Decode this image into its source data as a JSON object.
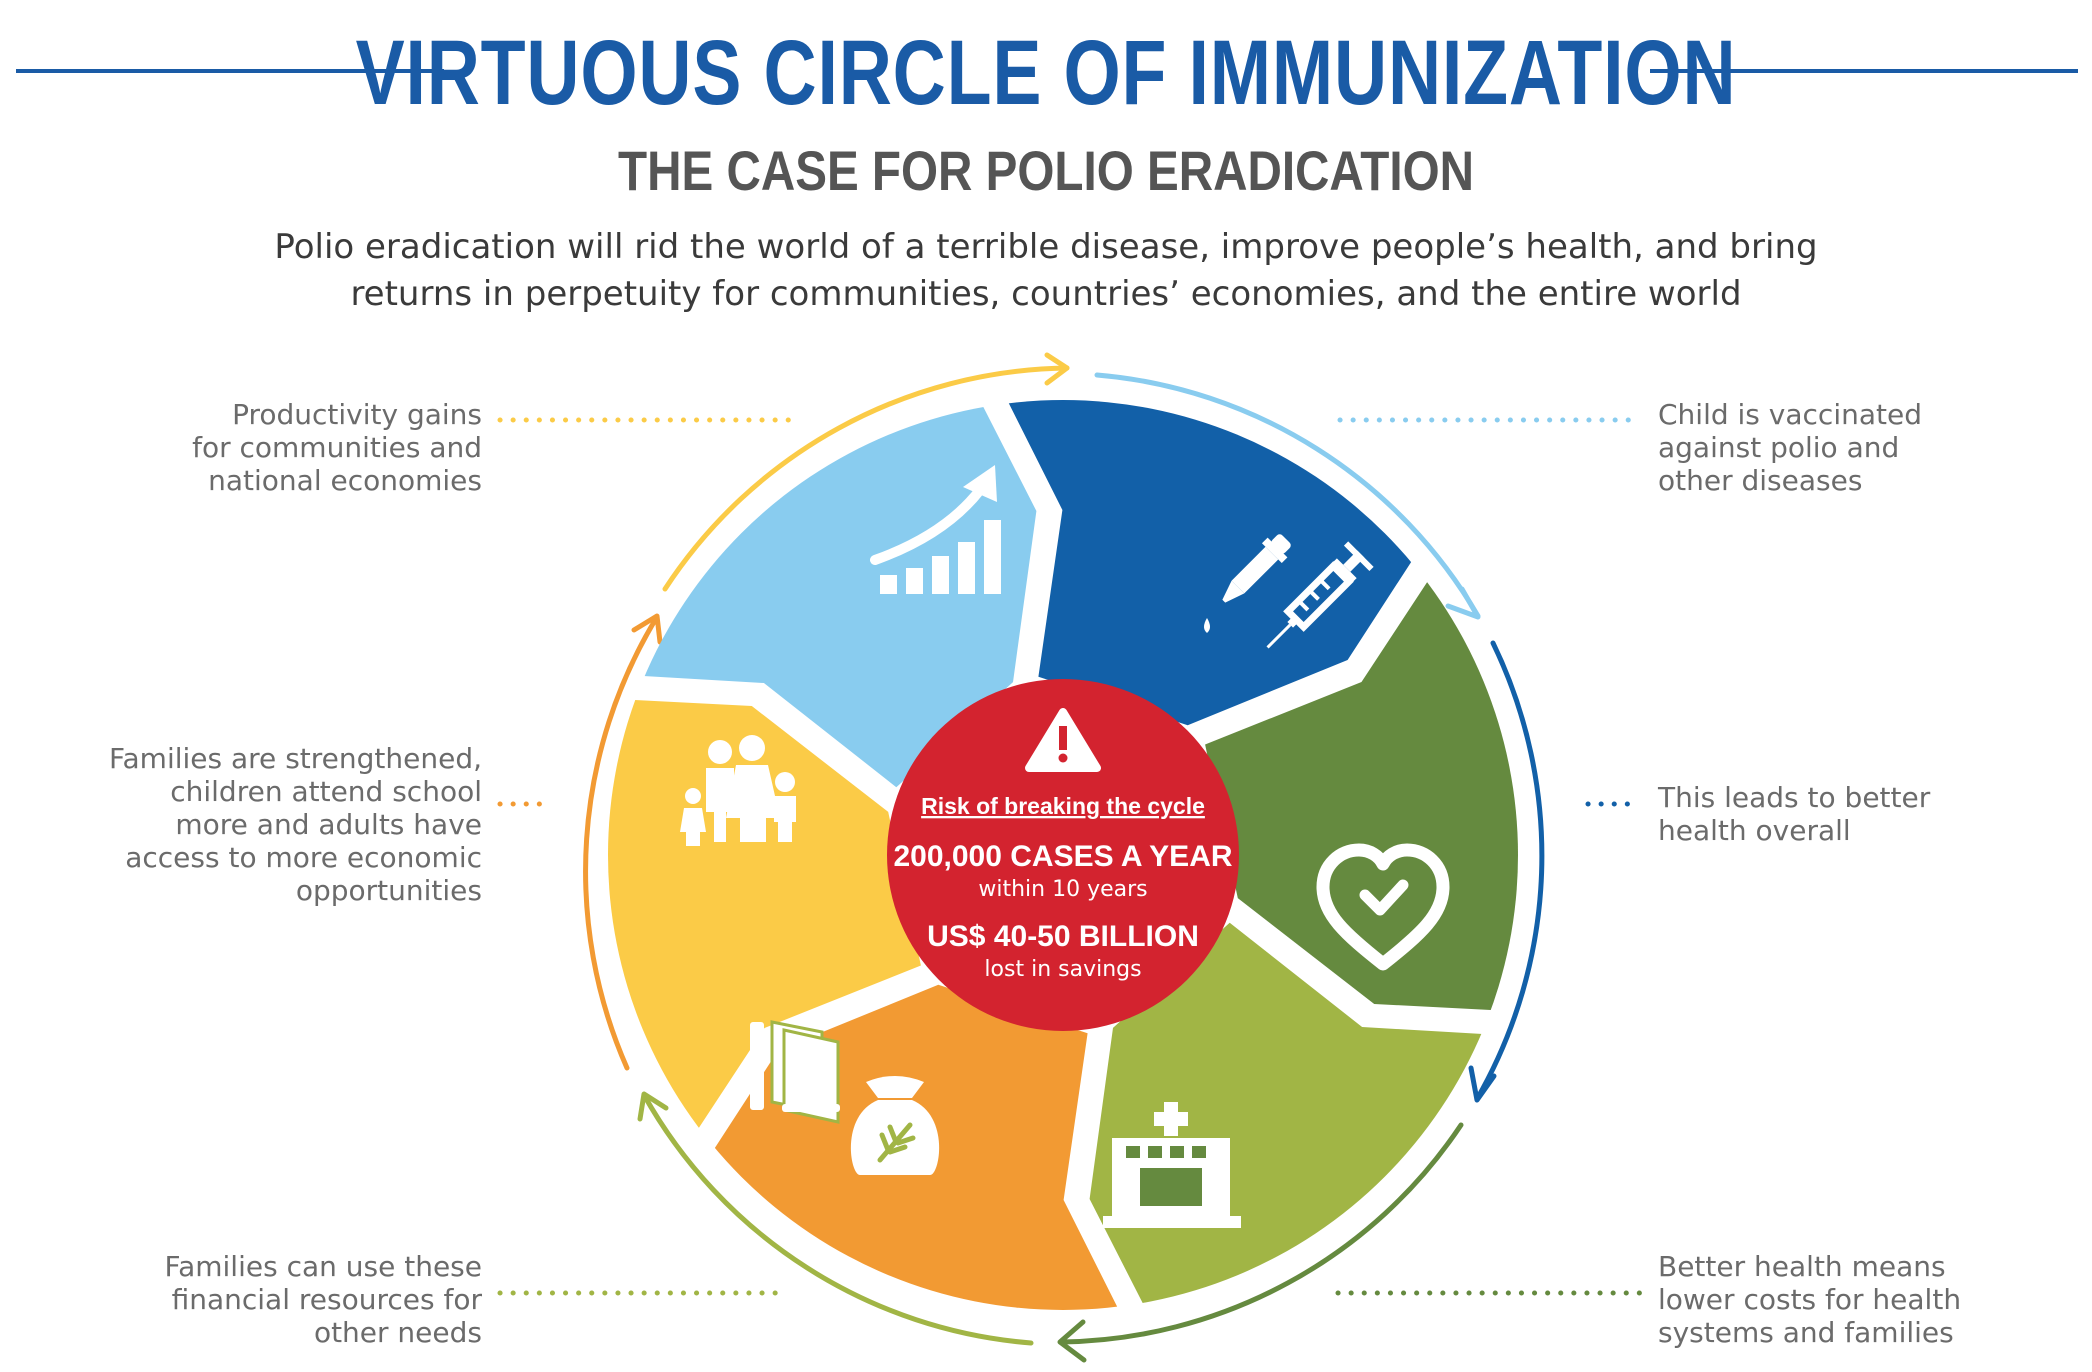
{
  "header": {
    "title": "VIRTUOUS CIRCLE OF IMMUNIZATION",
    "subtitle": "THE CASE FOR POLIO ERADICATION",
    "intro_line1": "Polio eradication will rid the world of a terrible disease, improve people’s health, and bring",
    "intro_line2": "returns in perpetuity for communities, countries’ economies, and the entire world"
  },
  "center": {
    "heading": "Risk of breaking the cycle",
    "stat1": "200,000 CASES A YEAR",
    "stat1_note": "within 10 years",
    "stat2": "US$ 40-50 BILLION",
    "stat2_note": "lost in savings"
  },
  "segments": [
    {
      "id": "vaccinated",
      "icon": "dropper-syringe-icon",
      "color": "#89CCEF",
      "arrow_color": "#89CCEF",
      "caption": [
        "Child is vaccinated",
        "against polio and",
        "other diseases"
      ]
    },
    {
      "id": "health",
      "icon": "heart-check-icon",
      "color": "#1260A8",
      "arrow_color": "#1260A8",
      "caption": [
        "This leads to better",
        "health overall"
      ]
    },
    {
      "id": "costs",
      "icon": "hospital-icon",
      "color": "#658A3F",
      "arrow_color": "#658A3F",
      "caption": [
        "Better health means",
        "lower costs for health",
        "systems and families"
      ]
    },
    {
      "id": "resources",
      "icon": "books-moneybag-icon",
      "color": "#A1B545",
      "arrow_color": "#A1B545",
      "caption": [
        "Families can use these",
        "financial resources for",
        "other needs"
      ]
    },
    {
      "id": "families",
      "icon": "family-icon",
      "color": "#F29A33",
      "arrow_color": "#F29A33",
      "caption": [
        "Families are strengthened,",
        "children attend school",
        "more and adults have",
        "access to more economic",
        "opportunities"
      ]
    },
    {
      "id": "productivity",
      "icon": "growth-chart-icon",
      "color": "#FBCB47",
      "arrow_color": "#FBCB47",
      "caption": [
        "Productivity gains",
        "for communities and",
        "national economies"
      ]
    }
  ],
  "colors": {
    "title": "#1A5BA6",
    "subtitle": "#555555",
    "intro": "#3A3A3A",
    "caption": "#6B6B6B",
    "center": "#D3232F"
  }
}
